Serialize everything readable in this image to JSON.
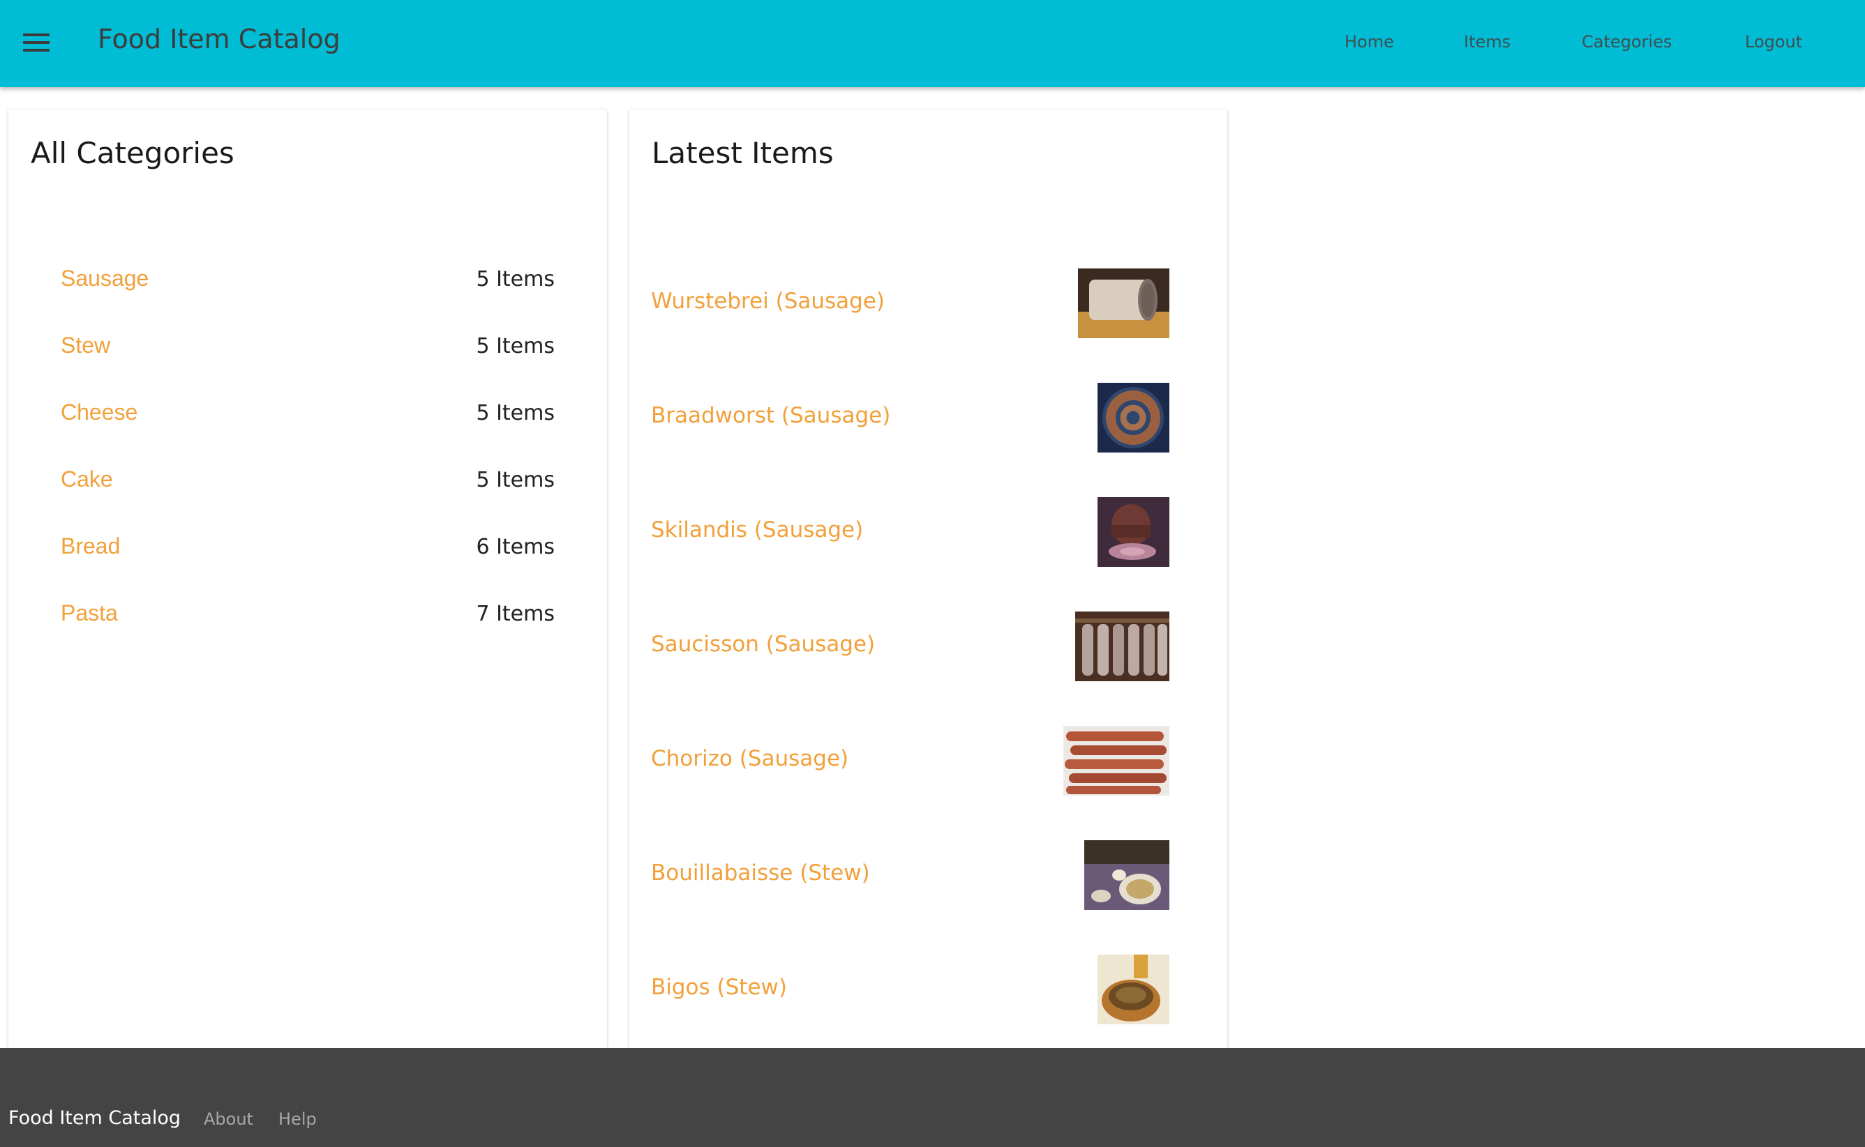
{
  "header": {
    "title": "Food Item Catalog",
    "nav": {
      "home": "Home",
      "items": "Items",
      "categories": "Categories",
      "logout": "Logout"
    }
  },
  "colors": {
    "header_bg": "#00bcd4",
    "link_accent": "#f2a03a",
    "footer_bg": "#444444"
  },
  "categories_panel": {
    "title": "All Categories",
    "items": [
      {
        "name": "Sausage",
        "count": "5 Items"
      },
      {
        "name": "Stew",
        "count": "5 Items"
      },
      {
        "name": "Cheese",
        "count": "5 Items"
      },
      {
        "name": "Cake",
        "count": "5 Items"
      },
      {
        "name": "Bread",
        "count": "6 Items"
      },
      {
        "name": "Pasta",
        "count": "7 Items"
      }
    ]
  },
  "latest_panel": {
    "title": "Latest Items",
    "items": [
      {
        "label": "Wurstebrei (Sausage)"
      },
      {
        "label": "Braadworst (Sausage)"
      },
      {
        "label": "Skilandis (Sausage)"
      },
      {
        "label": "Saucisson (Sausage)"
      },
      {
        "label": "Chorizo (Sausage)"
      },
      {
        "label": "Bouillabaisse (Stew)"
      },
      {
        "label": "Bigos (Stew)"
      }
    ]
  },
  "footer": {
    "title": "Food Item Catalog",
    "about": "About",
    "help": "Help"
  }
}
